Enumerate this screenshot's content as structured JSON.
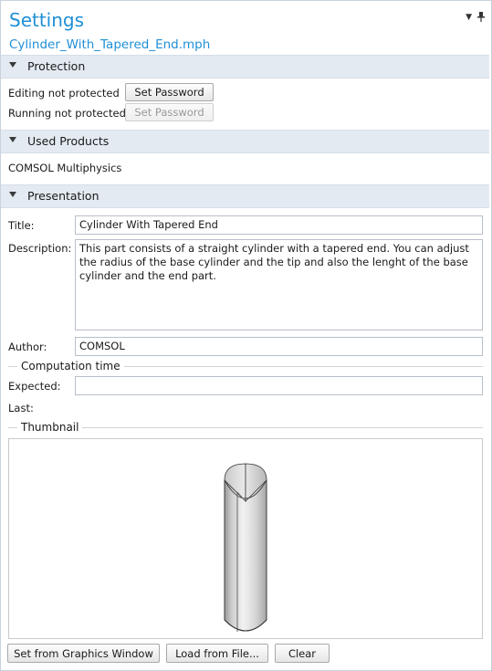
{
  "header": {
    "title": "Settings",
    "menu_icon": "chevron-down-icon",
    "pin_icon": "pin-icon"
  },
  "filename": "Cylinder_With_Tapered_End.mph",
  "protection": {
    "section_label": "Protection",
    "editing_label": "Editing not protected",
    "running_label": "Running not protected",
    "set_password_label": "Set Password",
    "set_password_disabled_label": "Set Password"
  },
  "used_products": {
    "section_label": "Used Products",
    "product": "COMSOL Multiphysics"
  },
  "presentation": {
    "section_label": "Presentation",
    "title_label": "Title:",
    "title_value": "Cylinder With Tapered End",
    "description_label": "Description:",
    "description_value": "This part consists of a straight cylinder with a tapered end. You can adjust the radius of the base cylinder and the tip and also the lenght of the base cylinder and the end part.",
    "author_label": "Author:",
    "author_value": "COMSOL",
    "computation_time_label": "Computation time",
    "expected_label": "Expected:",
    "expected_value": "",
    "last_label": "Last:",
    "thumbnail_label": "Thumbnail"
  },
  "buttons": {
    "set_from_graphics": "Set from Graphics Window",
    "load_from_file": "Load from File...",
    "clear": "Clear"
  },
  "colors": {
    "accent": "#1f8fd6",
    "section_bg": "#e3eaf2"
  }
}
